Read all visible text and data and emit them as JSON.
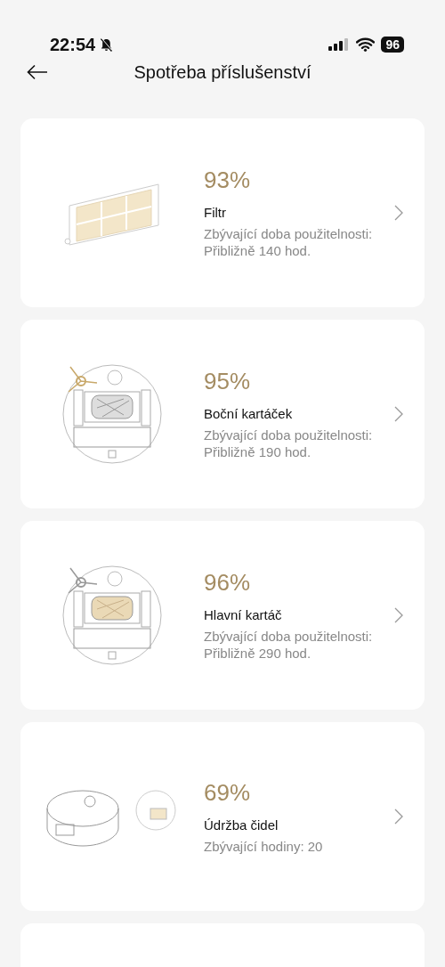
{
  "status_bar": {
    "time": "22:54",
    "battery": "96"
  },
  "header": {
    "title": "Spotřeba příslušenství"
  },
  "items": [
    {
      "kind": "filter",
      "percent": "93%",
      "name": "Filtr",
      "lines": [
        "Zbývající doba použitelnosti:",
        "Přibližně 140 hod."
      ]
    },
    {
      "kind": "side-brush",
      "percent": "95%",
      "name": "Boční kartáček",
      "lines": [
        "Zbývající doba použitelnosti:",
        "Přibližně 190 hod."
      ]
    },
    {
      "kind": "main-brush",
      "percent": "96%",
      "name": "Hlavní kartáč",
      "lines": [
        "Zbývající doba použitelnosti:",
        "Přibližně 290 hod."
      ]
    },
    {
      "kind": "sensor",
      "percent": "69%",
      "name": "Údržba čidel",
      "lines": [
        "Zbývající hodiny: 20"
      ]
    }
  ]
}
